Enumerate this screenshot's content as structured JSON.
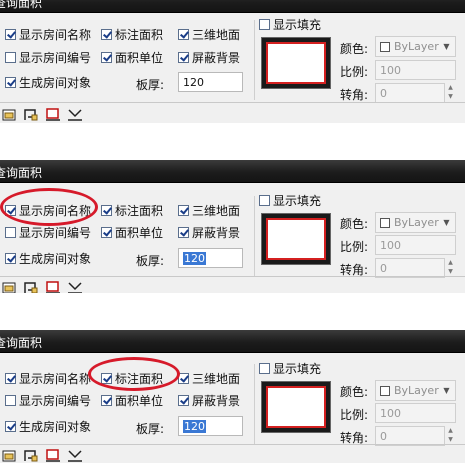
{
  "panels": [
    {
      "title": "查询面积",
      "show_room_name": "显示房间名称",
      "show_room_number": "显示房间编号",
      "create_room_object": "生成房间对象",
      "mark_area": "标注面积",
      "area_unit": "面积单位",
      "floor_thickness_label": "板厚:",
      "floor_thickness_value": "120",
      "three_d_floor": "三维地面",
      "mask_background": "屏蔽背景",
      "show_fill": "显示填充",
      "color_label": "颜色:",
      "color_value": "ByLayer",
      "scale_label": "比例:",
      "scale_value": "100",
      "rotate_label": "转角:",
      "rotate_value": "0"
    },
    {
      "title": "查询面积",
      "show_room_name": "显示房间名称",
      "show_room_number": "显示房间编号",
      "create_room_object": "生成房间对象",
      "mark_area": "标注面积",
      "area_unit": "面积单位",
      "floor_thickness_label": "板厚:",
      "floor_thickness_value": "120",
      "three_d_floor": "三维地面",
      "mask_background": "屏蔽背景",
      "show_fill": "显示填充",
      "color_label": "颜色:",
      "color_value": "ByLayer",
      "scale_label": "比例:",
      "scale_value": "100",
      "rotate_label": "转角:",
      "rotate_value": "0"
    },
    {
      "title": "查询面积",
      "show_room_name": "显示房间名称",
      "show_room_number": "显示房间编号",
      "create_room_object": "生成房间对象",
      "mark_area": "标注面积",
      "area_unit": "面积单位",
      "floor_thickness_label": "板厚:",
      "floor_thickness_value": "120",
      "three_d_floor": "三维地面",
      "mask_background": "屏蔽背景",
      "show_fill": "显示填充",
      "color_label": "颜色:",
      "color_value": "ByLayer",
      "scale_label": "比例:",
      "scale_value": "100",
      "rotate_label": "转角:",
      "rotate_value": "0"
    }
  ],
  "checkbox_states": {
    "show_room_name": true,
    "show_room_number": false,
    "create_room_object": true,
    "mark_area": true,
    "area_unit": true,
    "three_d_floor": true,
    "mask_background": true,
    "show_fill": false
  },
  "toolbar_icons": [
    "select-room-icon",
    "select-polyline-icon",
    "pick-point-icon",
    "draw-area-icon"
  ],
  "colors": {
    "titlebar": "#1c1c1c",
    "highlight_ellipse": "#d61a2a",
    "preview_border": "#d42020"
  }
}
